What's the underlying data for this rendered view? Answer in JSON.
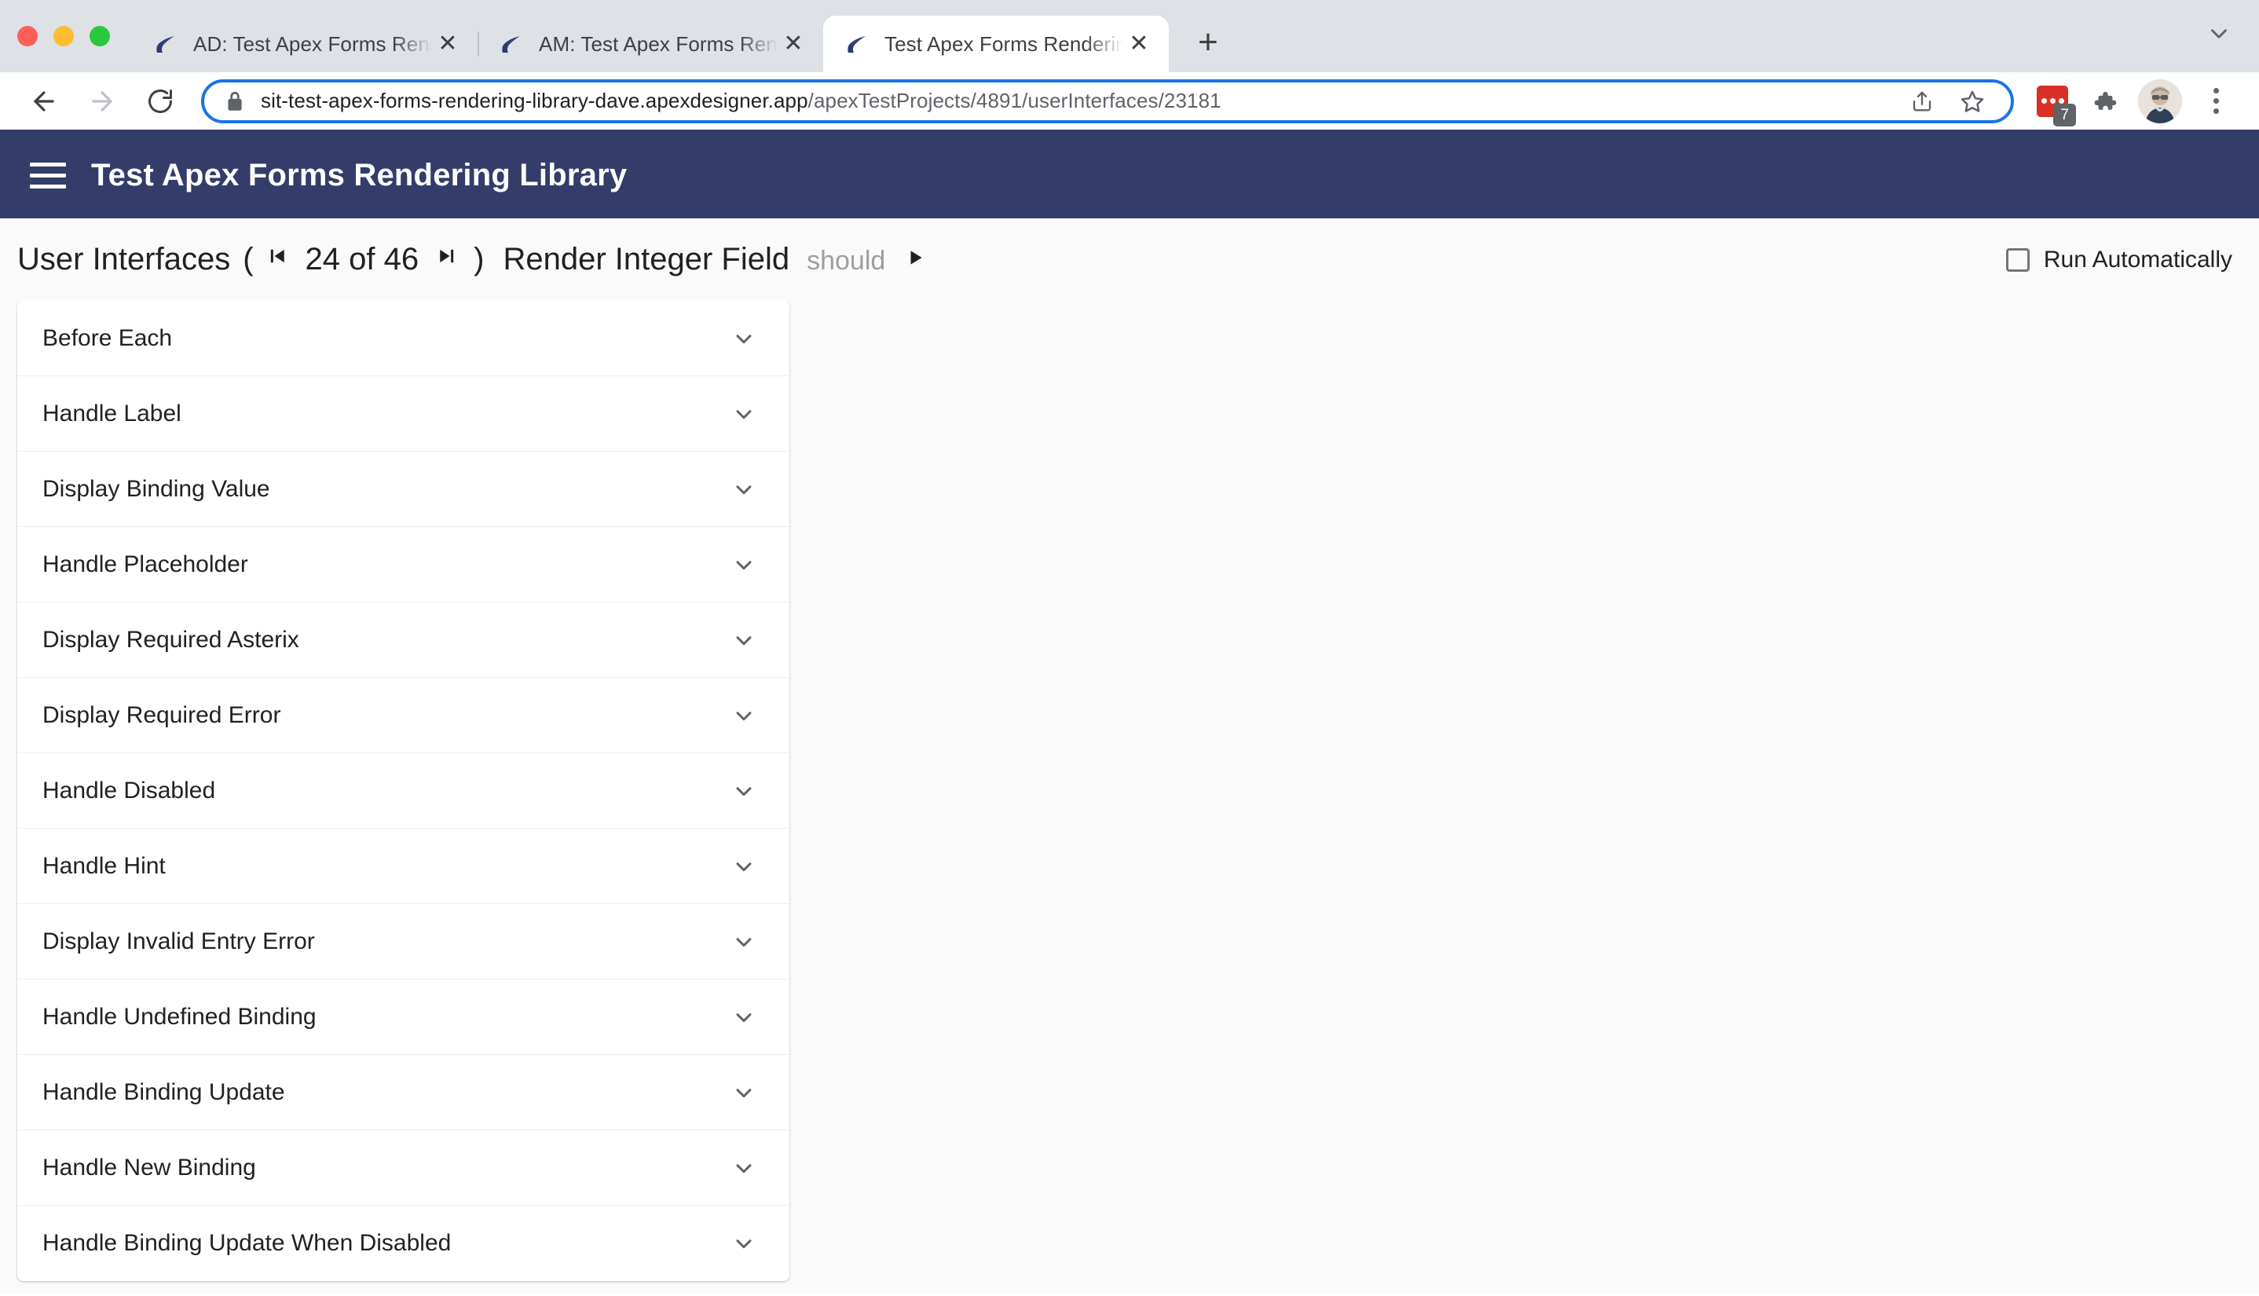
{
  "browser": {
    "window_controls": [
      "close",
      "minimize",
      "maximize"
    ],
    "tabs": [
      {
        "title": "AD: Test Apex Forms Rendering",
        "favicon": "apex-road-favicon",
        "active": false,
        "close_label": "✕"
      },
      {
        "title": "AM: Test Apex Forms Rendering",
        "favicon": "apex-road-favicon",
        "active": false,
        "close_label": "✕"
      },
      {
        "title": "Test Apex Forms Rendering Lib",
        "favicon": "apex-road-favicon",
        "active": true,
        "close_label": "✕"
      }
    ],
    "new_tab_label": "+",
    "tabstrip_menu_label": "⌄",
    "nav": {
      "back_label": "←",
      "forward_label": "→",
      "reload_label": "↻"
    },
    "omnibox": {
      "lock_icon": "lock-icon",
      "url_host": "sit-test-apex-forms-rendering-library-dave.apexdesigner.app",
      "url_path": "/apexTestProjects/4891/userInterfaces/23181",
      "share_icon": "share-icon",
      "bookmark_icon": "star-icon"
    },
    "extensions": {
      "red_extension_badge": "7",
      "puzzle_icon": "puzzle-piece-icon",
      "avatar_icon": "profile-avatar",
      "menu_icon": "kebab-menu-icon"
    }
  },
  "app": {
    "menu_icon": "hamburger-menu-icon",
    "title": "Test Apex Forms Rendering Library"
  },
  "page_header": {
    "title": "User Interfaces",
    "open_paren": "(",
    "close_paren": ")",
    "first_label": "⏮",
    "last_label": "⏭",
    "counter": "24 of 46",
    "current_index": 24,
    "total": 46,
    "subject": "Render Integer Field",
    "should_label": "should",
    "play_label": "▶",
    "run_automatically_label": "Run Automatically",
    "run_automatically_checked": false
  },
  "accordion": {
    "items": [
      {
        "label": "Before Each",
        "expanded": false
      },
      {
        "label": "Handle Label",
        "expanded": false
      },
      {
        "label": "Display Binding Value",
        "expanded": false
      },
      {
        "label": "Handle Placeholder",
        "expanded": false
      },
      {
        "label": "Display Required Asterix",
        "expanded": false
      },
      {
        "label": "Display Required Error",
        "expanded": false
      },
      {
        "label": "Handle Disabled",
        "expanded": false
      },
      {
        "label": "Handle Hint",
        "expanded": false
      },
      {
        "label": "Display Invalid Entry Error",
        "expanded": false
      },
      {
        "label": "Handle Undefined Binding",
        "expanded": false
      },
      {
        "label": "Handle Binding Update",
        "expanded": false
      },
      {
        "label": "Handle New Binding",
        "expanded": false
      },
      {
        "label": "Handle Binding Update When Disabled",
        "expanded": false
      }
    ],
    "chevron_icon": "chevron-down-icon"
  },
  "colors": {
    "app_header": "#343c6a",
    "accent_omnibox": "#1a73e8",
    "page_bg": "#fafafa",
    "card_bg": "#ffffff",
    "extension_red": "#d93025"
  }
}
